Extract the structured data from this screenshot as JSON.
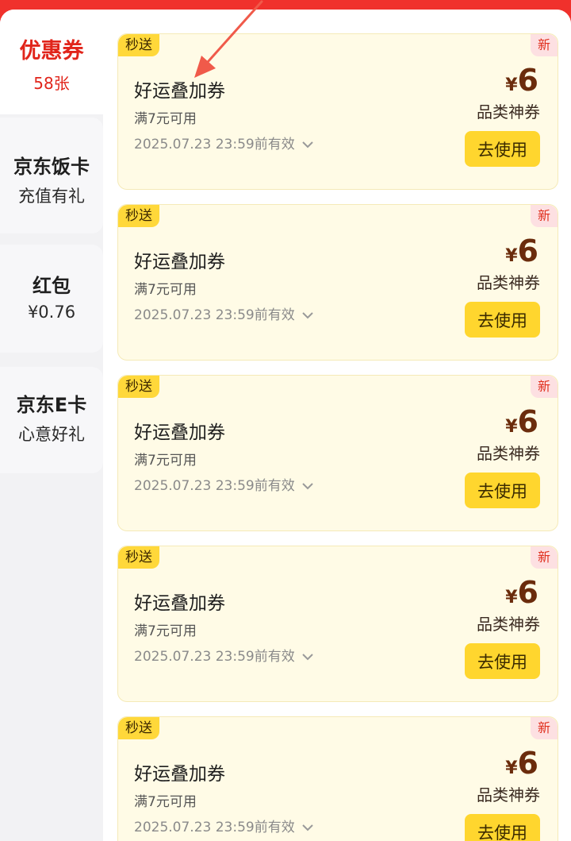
{
  "sidebar": {
    "tabs": [
      {
        "label": "优惠券",
        "sub": "58张",
        "active": true
      },
      {
        "label": "京东饭卡",
        "sub": "充值有礼",
        "active": false
      },
      {
        "label": "红包",
        "sub": "¥0.76",
        "active": false
      },
      {
        "label": "京东E卡",
        "sub": "心意好礼",
        "active": false
      }
    ]
  },
  "coupons": [
    {
      "badge": "秒送",
      "tag": "新",
      "title": "好运叠加券",
      "condition": "满7元可用",
      "expire": "2025.07.23 23:59前有效",
      "currency": "¥",
      "amount": "6",
      "category": "品类神券",
      "button": "去使用"
    },
    {
      "badge": "秒送",
      "tag": "新",
      "title": "好运叠加券",
      "condition": "满7元可用",
      "expire": "2025.07.23 23:59前有效",
      "currency": "¥",
      "amount": "6",
      "category": "品类神券",
      "button": "去使用"
    },
    {
      "badge": "秒送",
      "tag": "新",
      "title": "好运叠加券",
      "condition": "满7元可用",
      "expire": "2025.07.23 23:59前有效",
      "currency": "¥",
      "amount": "6",
      "category": "品类神券",
      "button": "去使用"
    },
    {
      "badge": "秒送",
      "tag": "新",
      "title": "好运叠加券",
      "condition": "满7元可用",
      "expire": "2025.07.23 23:59前有效",
      "currency": "¥",
      "amount": "6",
      "category": "品类神券",
      "button": "去使用"
    },
    {
      "badge": "秒送",
      "tag": "新",
      "title": "好运叠加券",
      "condition": "满7元可用",
      "expire": "2025.07.23 23:59前有效",
      "currency": "¥",
      "amount": "6",
      "category": "品类神券",
      "button": "去使用"
    }
  ],
  "colors": {
    "brand_red": "#e1251b",
    "card_bg": "#fffbe6",
    "button_yellow": "#ffd62e",
    "price_brown": "#6b2c0c",
    "annotation_arrow": "#f05a4a"
  },
  "icons": {
    "expand": "chevron-down-icon",
    "annotation": "arrow-pointer-icon"
  }
}
